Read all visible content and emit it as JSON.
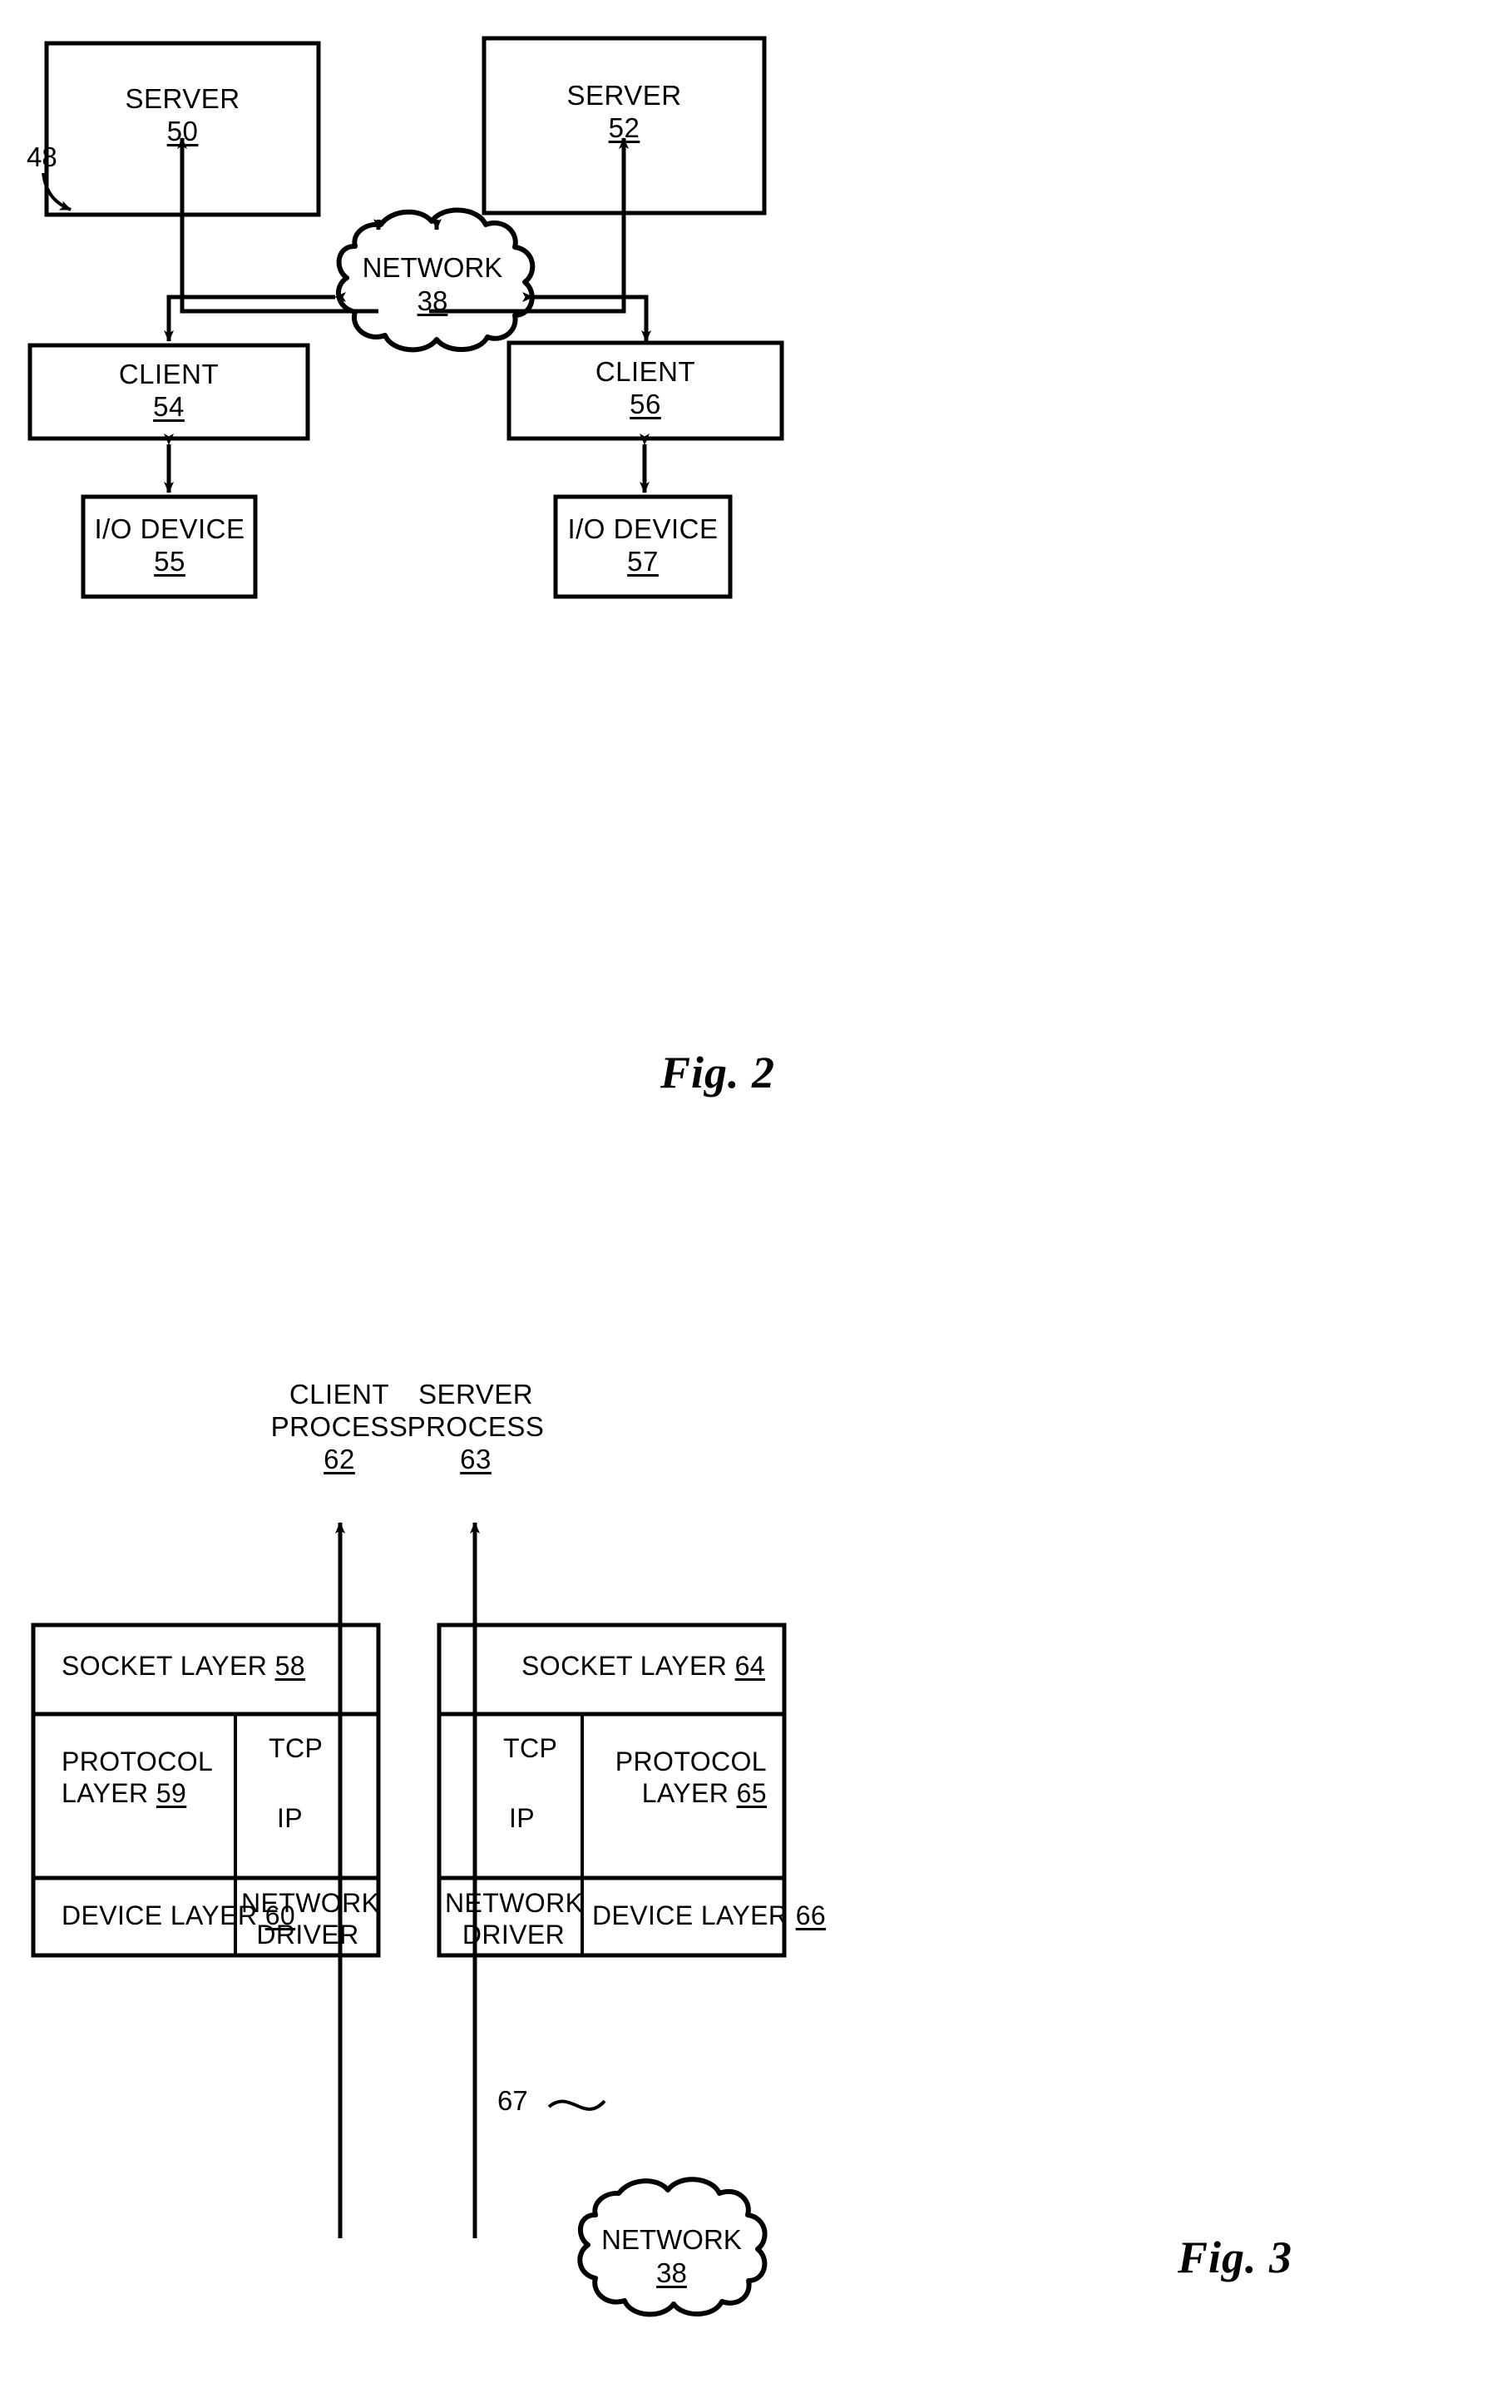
{
  "figures": [
    {
      "id": "fig2",
      "caption": "Fig. 2",
      "system_ref": "48",
      "nodes": [
        {
          "name": "server-50",
          "label": "SERVER",
          "num": "50"
        },
        {
          "name": "server-52",
          "label": "SERVER",
          "num": "52"
        },
        {
          "name": "network-cloud",
          "label": "NETWORK",
          "num": "38"
        },
        {
          "name": "client-54",
          "label": "CLIENT",
          "num": "54"
        },
        {
          "name": "client-56",
          "label": "CLIENT",
          "num": "56"
        },
        {
          "name": "io-device-55",
          "label": "I/O DEVICE",
          "num": "55"
        },
        {
          "name": "io-device-57",
          "label": "I/O DEVICE",
          "num": "57"
        }
      ]
    },
    {
      "id": "fig3",
      "caption": "Fig. 3",
      "link_ref": "67",
      "processes": [
        {
          "name": "client-process",
          "line1": "CLIENT",
          "line2": "PROCESS",
          "num": "62"
        },
        {
          "name": "server-process",
          "line1": "SERVER",
          "line2": "PROCESS",
          "num": "63"
        }
      ],
      "left_stack": {
        "socket_layer": {
          "label": "SOCKET LAYER",
          "num": "58"
        },
        "protocol_layer": {
          "label_line1": "PROTOCOL",
          "label_line2": "LAYER",
          "num": "59",
          "tcp": "TCP",
          "ip": "IP"
        },
        "device_layer": {
          "label": "DEVICE LAYER",
          "num": "60",
          "driver_line1": "NETWORK",
          "driver_line2": "DRIVER"
        }
      },
      "right_stack": {
        "socket_layer": {
          "label": "SOCKET LAYER",
          "num": "64"
        },
        "protocol_layer": {
          "label_line1": "PROTOCOL",
          "label_line2": "LAYER",
          "num": "65",
          "tcp": "TCP",
          "ip": "IP"
        },
        "device_layer": {
          "label": "DEVICE LAYER",
          "num": "66",
          "driver_line1": "NETWORK",
          "driver_line2": "DRIVER"
        }
      },
      "network_cloud": {
        "label": "NETWORK",
        "num": "38"
      }
    }
  ],
  "colors": {
    "ink": "#000000",
    "paper": "#ffffff"
  }
}
